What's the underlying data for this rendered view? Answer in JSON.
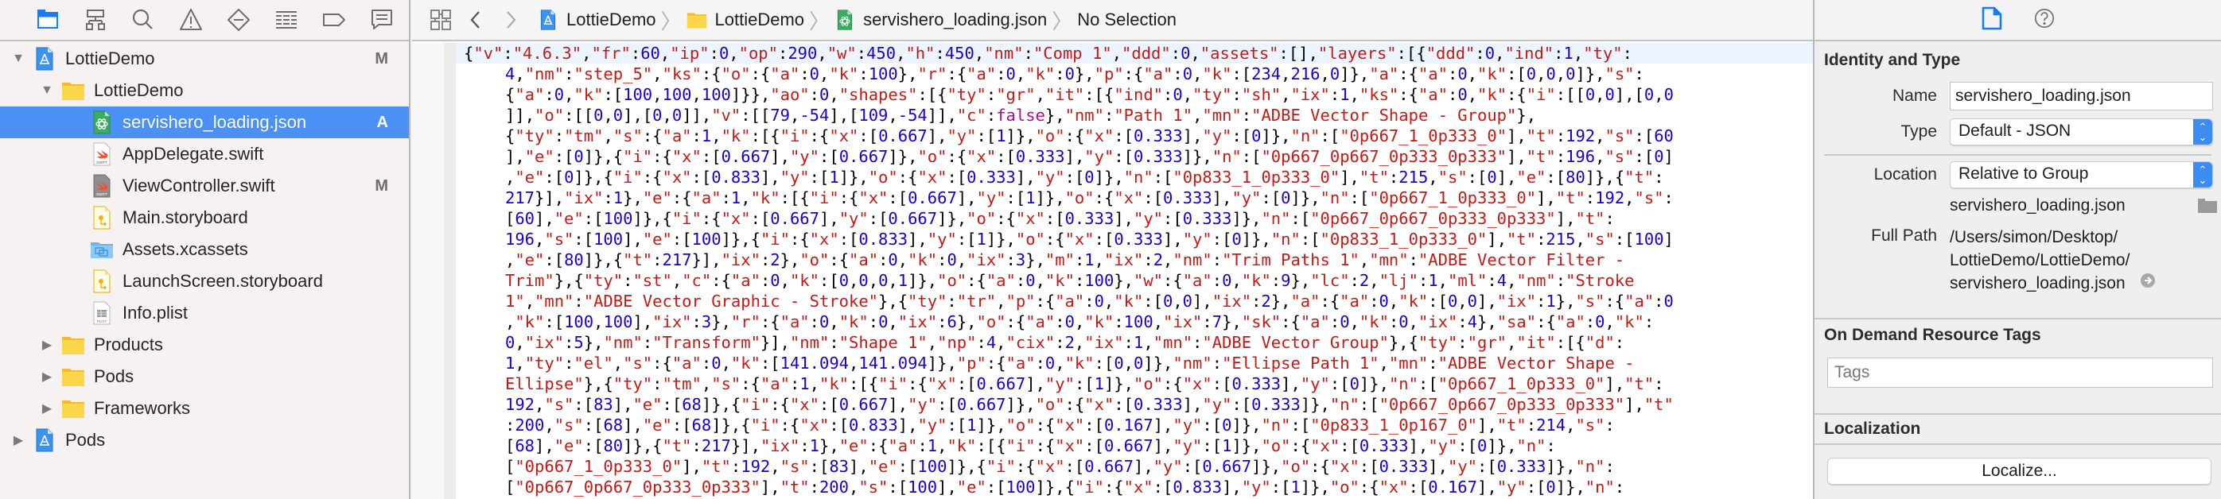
{
  "navigator": {
    "toolbar_icons": [
      {
        "name": "project-navigator-icon",
        "active": true
      },
      {
        "name": "symbol-navigator-icon",
        "active": false
      },
      {
        "name": "find-navigator-icon",
        "active": false
      },
      {
        "name": "issue-navigator-icon",
        "active": false
      },
      {
        "name": "test-navigator-icon",
        "active": false
      },
      {
        "name": "debug-navigator-icon",
        "active": false
      },
      {
        "name": "breakpoint-navigator-icon",
        "active": false
      },
      {
        "name": "report-navigator-icon",
        "active": false
      }
    ],
    "tree": [
      {
        "label": "LottieDemo",
        "icon": "xcode-project-icon",
        "level": 0,
        "disclosure": "expanded",
        "badge": "M",
        "selected": false
      },
      {
        "label": "LottieDemo",
        "icon": "folder-icon",
        "level": 1,
        "disclosure": "expanded",
        "badge": "",
        "selected": false
      },
      {
        "label": "servishero_loading.json",
        "icon": "json-file-icon",
        "level": 2,
        "disclosure": "none",
        "badge": "A",
        "selected": true
      },
      {
        "label": "AppDelegate.swift",
        "icon": "swift-file-icon",
        "level": 2,
        "disclosure": "none",
        "badge": "",
        "selected": false
      },
      {
        "label": "ViewController.swift",
        "icon": "swift-file-icon",
        "level": 2,
        "disclosure": "none",
        "badge": "M",
        "selected": false
      },
      {
        "label": "Main.storyboard",
        "icon": "storyboard-file-icon",
        "level": 2,
        "disclosure": "none",
        "badge": "",
        "selected": false
      },
      {
        "label": "Assets.xcassets",
        "icon": "asset-catalog-icon",
        "level": 2,
        "disclosure": "none",
        "badge": "",
        "selected": false
      },
      {
        "label": "LaunchScreen.storyboard",
        "icon": "storyboard-file-icon",
        "level": 2,
        "disclosure": "none",
        "badge": "",
        "selected": false
      },
      {
        "label": "Info.plist",
        "icon": "plist-file-icon",
        "level": 2,
        "disclosure": "none",
        "badge": "",
        "selected": false
      },
      {
        "label": "Products",
        "icon": "folder-icon",
        "level": 1,
        "disclosure": "collapsed",
        "badge": "",
        "selected": false
      },
      {
        "label": "Pods",
        "icon": "folder-icon",
        "level": 1,
        "disclosure": "collapsed",
        "badge": "",
        "selected": false
      },
      {
        "label": "Frameworks",
        "icon": "folder-icon",
        "level": 1,
        "disclosure": "collapsed",
        "badge": "",
        "selected": false
      },
      {
        "label": "Pods",
        "icon": "xcode-project-icon",
        "level": 0,
        "disclosure": "collapsed",
        "badge": "",
        "selected": false
      }
    ]
  },
  "jumpbar": {
    "crumbs": [
      {
        "label": "LottieDemo",
        "icon": "xcode-project-icon"
      },
      {
        "label": "LottieDemo",
        "icon": "folder-icon"
      },
      {
        "label": "servishero_loading.json",
        "icon": "json-file-icon"
      },
      {
        "label": "No Selection",
        "icon": ""
      }
    ]
  },
  "editor": {
    "lines": [
      "{\"v\":\"4.6.3\",\"fr\":60,\"ip\":0,\"op\":290,\"w\":450,\"h\":450,\"nm\":\"Comp 1\",\"ddd\":0,\"assets\":[],\"layers\":[{\"ddd\":0,\"ind\":1,\"ty\":",
      "4,\"nm\":\"step_5\",\"ks\":{\"o\":{\"a\":0,\"k\":100},\"r\":{\"a\":0,\"k\":0},\"p\":{\"a\":0,\"k\":[234,216,0]},\"a\":{\"a\":0,\"k\":[0,0,0]},\"s\":",
      "{\"a\":0,\"k\":[100,100,100]}},\"ao\":0,\"shapes\":[{\"ty\":\"gr\",\"it\":[{\"ind\":0,\"ty\":\"sh\",\"ix\":1,\"ks\":{\"a\":0,\"k\":{\"i\":[[0,0],[0,0",
      "]],\"o\":[[0,0],[0,0]],\"v\":[[79,-54],[109,-54]],\"c\":false},\"nm\":\"Path 1\",\"mn\":\"ADBE Vector Shape - Group\"},",
      "{\"ty\":\"tm\",\"s\":{\"a\":1,\"k\":[{\"i\":{\"x\":[0.667],\"y\":[1]},\"o\":{\"x\":[0.333],\"y\":[0]},\"n\":[\"0p667_1_0p333_0\"],\"t\":192,\"s\":[60",
      "],\"e\":[0]},{\"i\":{\"x\":[0.667],\"y\":[0.667]},\"o\":{\"x\":[0.333],\"y\":[0.333]},\"n\":[\"0p667_0p667_0p333_0p333\"],\"t\":196,\"s\":[0]",
      ",\"e\":[0]},{\"i\":{\"x\":[0.833],\"y\":[1]},\"o\":{\"x\":[0.333],\"y\":[0]},\"n\":[\"0p833_1_0p333_0\"],\"t\":215,\"s\":[0],\"e\":[80]},{\"t\":",
      "217}],\"ix\":1},\"e\":{\"a\":1,\"k\":[{\"i\":{\"x\":[0.667],\"y\":[1]},\"o\":{\"x\":[0.333],\"y\":[0]},\"n\":[\"0p667_1_0p333_0\"],\"t\":192,\"s\":",
      "[60],\"e\":[100]},{\"i\":{\"x\":[0.667],\"y\":[0.667]},\"o\":{\"x\":[0.333],\"y\":[0.333]},\"n\":[\"0p667_0p667_0p333_0p333\"],\"t\":",
      "196,\"s\":[100],\"e\":[100]},{\"i\":{\"x\":[0.833],\"y\":[1]},\"o\":{\"x\":[0.333],\"y\":[0]},\"n\":[\"0p833_1_0p333_0\"],\"t\":215,\"s\":[100]",
      ",\"e\":[80]},{\"t\":217}],\"ix\":2},\"o\":{\"a\":0,\"k\":0,\"ix\":3},\"m\":1,\"ix\":2,\"nm\":\"Trim Paths 1\",\"mn\":\"ADBE Vector Filter -",
      "Trim\"},{\"ty\":\"st\",\"c\":{\"a\":0,\"k\":[0,0,0,1]},\"o\":{\"a\":0,\"k\":100},\"w\":{\"a\":0,\"k\":9},\"lc\":2,\"lj\":1,\"ml\":4,\"nm\":\"Stroke",
      "1\",\"mn\":\"ADBE Vector Graphic - Stroke\"},{\"ty\":\"tr\",\"p\":{\"a\":0,\"k\":[0,0],\"ix\":2},\"a\":{\"a\":0,\"k\":[0,0],\"ix\":1},\"s\":{\"a\":0",
      ",\"k\":[100,100],\"ix\":3},\"r\":{\"a\":0,\"k\":0,\"ix\":6},\"o\":{\"a\":0,\"k\":100,\"ix\":7},\"sk\":{\"a\":0,\"k\":0,\"ix\":4},\"sa\":{\"a\":0,\"k\":",
      "0,\"ix\":5},\"nm\":\"Transform\"}],\"nm\":\"Shape 1\",\"np\":4,\"cix\":2,\"ix\":1,\"mn\":\"ADBE Vector Group\"},{\"ty\":\"gr\",\"it\":[{\"d\":",
      "1,\"ty\":\"el\",\"s\":{\"a\":0,\"k\":[141.094,141.094]},\"p\":{\"a\":0,\"k\":[0,0]},\"nm\":\"Ellipse Path 1\",\"mn\":\"ADBE Vector Shape -",
      "Ellipse\"},{\"ty\":\"tm\",\"s\":{\"a\":1,\"k\":[{\"i\":{\"x\":[0.667],\"y\":[1]},\"o\":{\"x\":[0.333],\"y\":[0]},\"n\":[\"0p667_1_0p333_0\"],\"t\":",
      "192,\"s\":[83],\"e\":[68]},{\"i\":{\"x\":[0.667],\"y\":[0.667]},\"o\":{\"x\":[0.333],\"y\":[0.333]},\"n\":[\"0p667_0p667_0p333_0p333\"],\"t\"",
      ":200,\"s\":[68],\"e\":[68]},{\"i\":{\"x\":[0.833],\"y\":[1]},\"o\":{\"x\":[0.167],\"y\":[0]},\"n\":[\"0p833_1_0p167_0\"],\"t\":214,\"s\":",
      "[68],\"e\":[80]},{\"t\":217}],\"ix\":1},\"e\":{\"a\":1,\"k\":[{\"i\":{\"x\":[0.667],\"y\":[1]},\"o\":{\"x\":[0.333],\"y\":[0]},\"n\":",
      "[\"0p667_1_0p333_0\"],\"t\":192,\"s\":[83],\"e\":[100]},{\"i\":{\"x\":[0.667],\"y\":[0.667]},\"o\":{\"x\":[0.333],\"y\":[0.333]},\"n\":",
      "[\"0p667_0p667_0p333_0p333\"],\"t\":200,\"s\":[100],\"e\":[100]},{\"i\":{\"x\":[0.833],\"y\":[1]},\"o\":{\"x\":[0.167],\"y\":[0]},\"n\":"
    ],
    "syntax_colors": {
      "string": "#c41a16",
      "number": "#1c00cf",
      "keyword": "#aa0d91",
      "punctuation": "#000000"
    }
  },
  "inspector": {
    "toolbar_icons": [
      {
        "name": "file-inspector-icon",
        "active": true
      },
      {
        "name": "quick-help-icon",
        "active": false
      }
    ],
    "identity": {
      "title": "Identity and Type",
      "name_label": "Name",
      "name_value": "servishero_loading.json",
      "type_label": "Type",
      "type_value": "Default - JSON",
      "location_label": "Location",
      "location_value": "Relative to Group",
      "location_path": "servishero_loading.json",
      "full_path_label": "Full Path",
      "full_path_lines": [
        "/Users/simon/Desktop/",
        "LottieDemo/LottieDemo/",
        "servishero_loading.json"
      ]
    },
    "odr": {
      "title": "On Demand Resource Tags",
      "tags_placeholder": "Tags"
    },
    "localization": {
      "title": "Localization",
      "button_label": "Localize..."
    }
  },
  "colors": {
    "selection": "#4a90f5",
    "accent": "#1a7cf5",
    "folder": "#f9c22d"
  }
}
